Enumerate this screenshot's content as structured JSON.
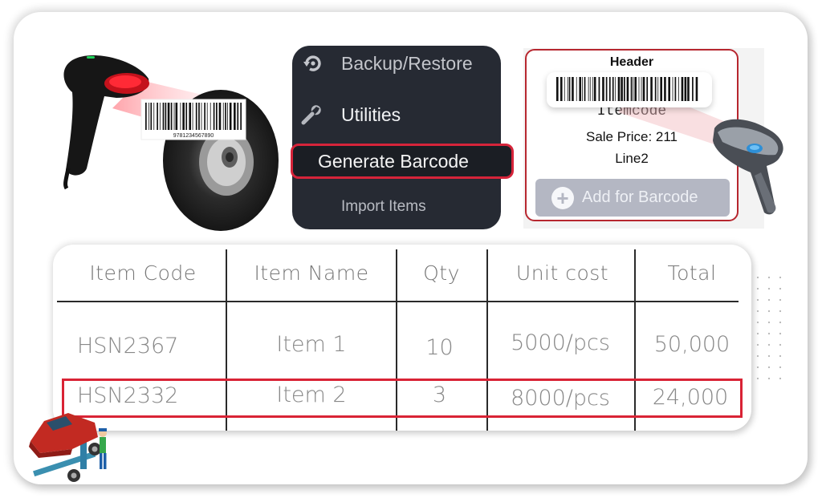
{
  "illustration_left": {
    "barcode_digits": "9781234567890"
  },
  "menu": {
    "items": [
      {
        "label": "Backup/Restore",
        "icon": "restore-icon"
      },
      {
        "label": "Utilities",
        "icon": "wrench-icon"
      },
      {
        "label": "Generate Barcode",
        "icon": "",
        "highlighted": true
      },
      {
        "label": "Import Items",
        "icon": ""
      }
    ]
  },
  "barcode_label": {
    "header": "Header",
    "itemcode": "Itemcode",
    "sale_price": "Sale Price: 211",
    "line2": "Line2",
    "add_button_label": "Add for Barcode",
    "add_button_icon": "plus-circle-icon"
  },
  "table": {
    "columns": [
      "Item Code",
      "Item Name",
      "Qty",
      "Unit cost",
      "Total"
    ],
    "rows": [
      {
        "code": "HSN2367",
        "name": "Item 1",
        "qty": "10",
        "unit_cost": "5000/pcs",
        "total": "50,000"
      },
      {
        "code": "HSN2332",
        "name": "Item 2",
        "qty": "3",
        "unit_cost": "8000/pcs",
        "total": "24,000",
        "highlighted": true
      }
    ]
  },
  "colors": {
    "accent_red": "#d92335",
    "menu_bg": "#262a33",
    "add_button_bg": "#b4b7c3"
  }
}
